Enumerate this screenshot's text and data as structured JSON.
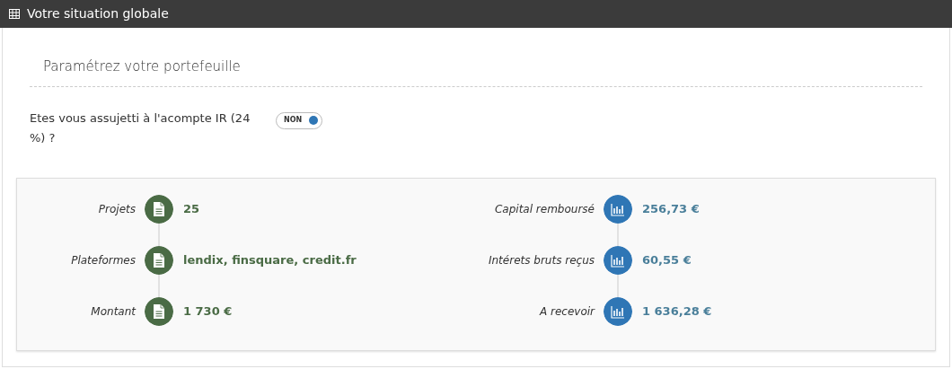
{
  "panel": {
    "title": "Votre situation globale"
  },
  "settings": {
    "title": "Paramétrez votre portefeuille",
    "question": "Etes vous assujetti à l'acompte IR (24 %) ?",
    "toggle": {
      "label": "NON",
      "on": false
    }
  },
  "summary": [
    {
      "kind": "document",
      "items": [
        {
          "label": "Projets",
          "value": "25"
        },
        {
          "label": "Plateformes",
          "value": "lendix, finsquare, credit.fr"
        },
        {
          "label": "Montant",
          "value": "1 730 €"
        }
      ]
    },
    {
      "kind": "chart",
      "items": [
        {
          "label": "Capital remboursé",
          "value": "256,73 €"
        },
        {
          "label": "Intérets bruts reçus",
          "value": "60,55 €"
        },
        {
          "label": "A recevoir",
          "value": "1 636,28 €"
        }
      ]
    }
  ]
}
